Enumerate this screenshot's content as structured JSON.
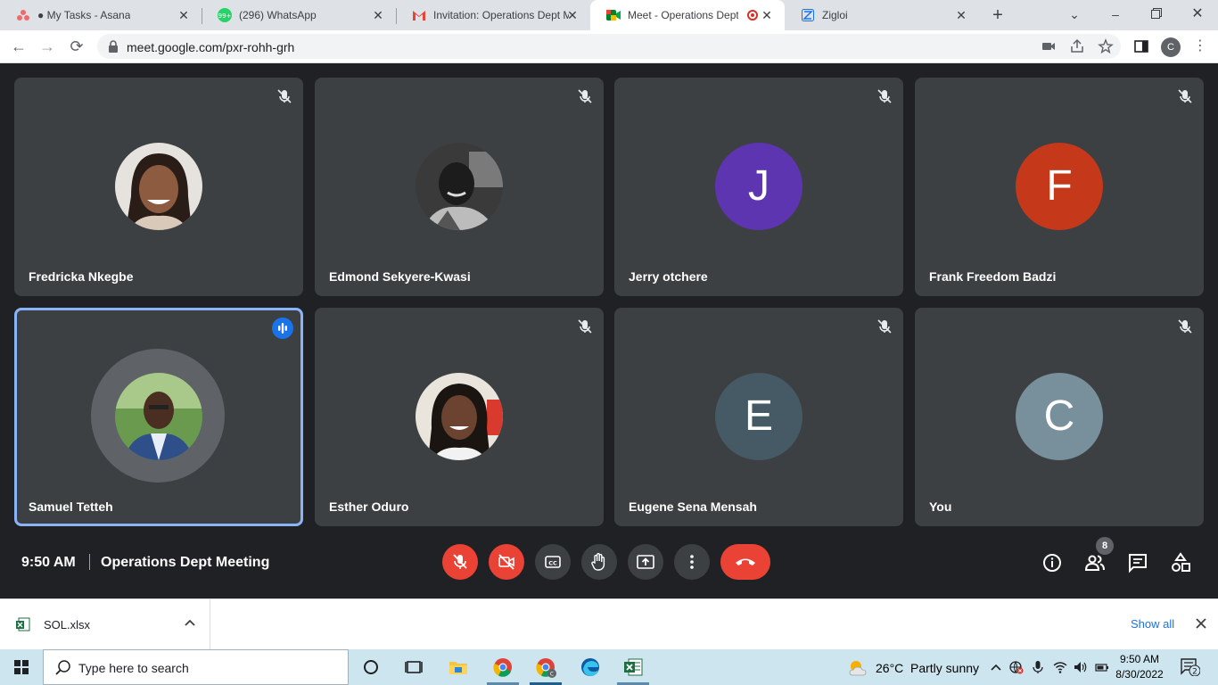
{
  "browser": {
    "tabs": [
      {
        "title": "● My Tasks - Asana",
        "favicon": "asana-icon"
      },
      {
        "title": "(296) WhatsApp",
        "favicon": "whatsapp-icon",
        "badge": "99+"
      },
      {
        "title": "Invitation: Operations Dept M",
        "favicon": "gmail-icon"
      },
      {
        "title": "Meet - Operations Dept",
        "favicon": "meet-icon",
        "active": true
      },
      {
        "title": "Zigloi",
        "favicon": "zigloi-icon"
      }
    ],
    "url": "meet.google.com/pxr-rohh-grh",
    "profile_initial": "C"
  },
  "meet": {
    "participants": [
      {
        "name": "Fredricka Nkegbe",
        "avatar_type": "photo",
        "muted": true
      },
      {
        "name": "Edmond Sekyere-Kwasi",
        "avatar_type": "photo",
        "muted": true
      },
      {
        "name": "Jerry otchere",
        "initial": "J",
        "color": "#5e35b1",
        "muted": true
      },
      {
        "name": "Frank Freedom Badzi",
        "initial": "F",
        "color": "#c5391a",
        "muted": true
      },
      {
        "name": "Samuel Tetteh",
        "avatar_type": "photo",
        "speaking": true
      },
      {
        "name": "Esther Oduro",
        "avatar_type": "photo",
        "muted": true
      },
      {
        "name": "Eugene Sena Mensah",
        "initial": "E",
        "color": "#455a64",
        "muted": true
      },
      {
        "name": "You",
        "initial": "C",
        "color": "#78909c",
        "muted": true
      }
    ],
    "time": "9:50 AM",
    "meeting_title": "Operations Dept Meeting",
    "participants_count": "8",
    "colors": {
      "accent": "#8ab4f8",
      "danger": "#ea4335",
      "tile": "#3c4043",
      "background": "#202124"
    }
  },
  "downloads": {
    "file_name": "SOL.xlsx",
    "show_all": "Show all"
  },
  "taskbar": {
    "search_placeholder": "Type here to search",
    "weather_temp": "26°C",
    "weather_desc": "Partly sunny",
    "clock_time": "9:50 AM",
    "clock_date": "8/30/2022",
    "notification_count": "2"
  }
}
